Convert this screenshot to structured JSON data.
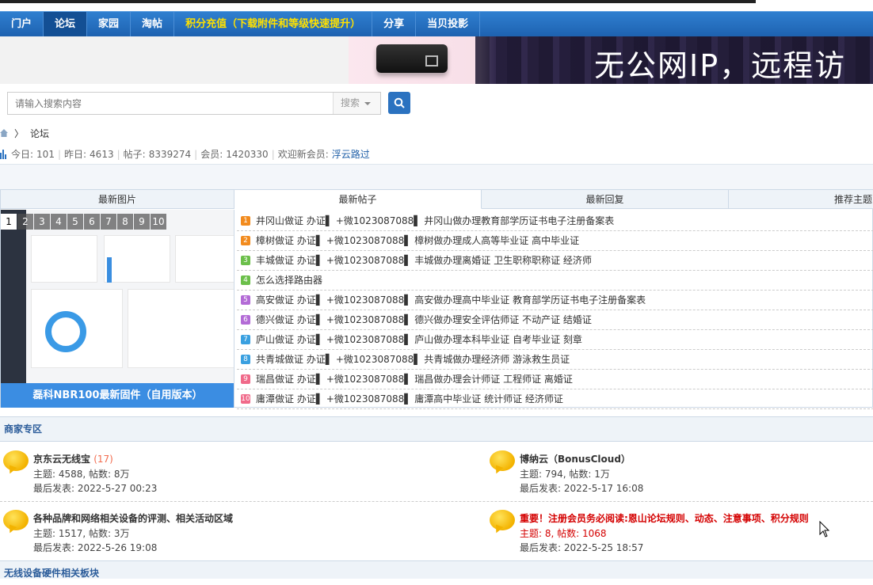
{
  "nav": {
    "items": [
      "门户",
      "论坛",
      "家园",
      "淘帖",
      "积分充值（下载附件和等级快速提升）",
      "分享",
      "当贝投影"
    ],
    "active_index": 1
  },
  "banner": {
    "slogan": "无公网IP，远程访"
  },
  "search": {
    "placeholder": "请输入搜索内容",
    "scope": "搜索"
  },
  "breadcrumb": {
    "current": "论坛"
  },
  "stats": {
    "today_label": "今日:",
    "today": "101",
    "yesterday_label": "昨日:",
    "yesterday": "4613",
    "posts_label": "帖子:",
    "posts": "8339274",
    "members_label": "会员:",
    "members": "1420330",
    "welcome_label": "欢迎新会员:",
    "new_member": "浮云路过"
  },
  "hot": {
    "pic_header": "最新图片",
    "tabs": [
      "最新帖子",
      "最新回复",
      "推荐主题"
    ],
    "pager": [
      "1",
      "2",
      "3",
      "4",
      "5",
      "6",
      "7",
      "8",
      "9",
      "10"
    ],
    "pic_caption": "磊科NBR100最新固件（自用版本）",
    "threads": [
      {
        "n": "1",
        "color": "#f28b1e",
        "text": "井冈山做证 办证▌ +微1023087088▌ 井冈山做办理教育部学历证书电子注册备案表"
      },
      {
        "n": "2",
        "color": "#f28b1e",
        "text": "樟树做证 办证▌ +微1023087088▌ 樟树做办理成人高等毕业证 高中毕业证"
      },
      {
        "n": "3",
        "color": "#6bbf4a",
        "text": "丰城做证 办证▌ +微1023087088▌ 丰城做办理离婚证 卫生职称职称证 经济师"
      },
      {
        "n": "4",
        "color": "#6bbf4a",
        "text": "怎么选择路由器"
      },
      {
        "n": "5",
        "color": "#b36bd6",
        "text": "高安做证 办证▌ +微1023087088▌ 高安做办理高中毕业证 教育部学历证书电子注册备案表"
      },
      {
        "n": "6",
        "color": "#b36bd6",
        "text": "德兴做证 办证▌ +微1023087088▌ 德兴做办理安全评估师证 不动产证 结婚证"
      },
      {
        "n": "7",
        "color": "#3aa0e0",
        "text": "庐山做证 办证▌ +微1023087088▌ 庐山做办理本科毕业证 自考毕业证 刻章"
      },
      {
        "n": "8",
        "color": "#3aa0e0",
        "text": "共青城做证 办证▌ +微1023087088▌ 共青城做办理经济师 游泳救生员证"
      },
      {
        "n": "9",
        "color": "#f06a8a",
        "text": "瑞昌做证 办证▌ +微1023087088▌ 瑞昌做办理会计师证 工程师证 离婚证"
      },
      {
        "n": "10",
        "color": "#f06a8a",
        "text": "庸潭做证 办证▌ +微1023087088▌ 庸潭高中毕业证 统计师证 经济师证"
      }
    ]
  },
  "merchant": {
    "title": "商家专区",
    "forums": [
      {
        "name": "京东云无线宝",
        "count": "(17)",
        "stats": "主题: 4588, 帖数: 8万",
        "last": "最后发表: 2022-5-27 00:23"
      },
      {
        "name": "博纳云（BonusCloud）",
        "count": "",
        "stats": "主题: 794, 帖数: 1万",
        "last": "最后发表: 2022-5-17 16:08"
      },
      {
        "name": "各种品牌和网络相关设备的评测、相关活动区域",
        "count": "",
        "stats": "主题: 1517, 帖数: 3万",
        "last": "最后发表: 2022-5-26 19:08"
      },
      {
        "name": "重要！注册会员务必阅读:恩山论坛规则、动态、注意事项、积分规则",
        "count": "",
        "stats": "主题: 8, 帖数: 1068",
        "last": "最后发表: 2022-5-25 18:57"
      }
    ]
  },
  "section2": {
    "title": "无线设备硬件相关板块"
  }
}
